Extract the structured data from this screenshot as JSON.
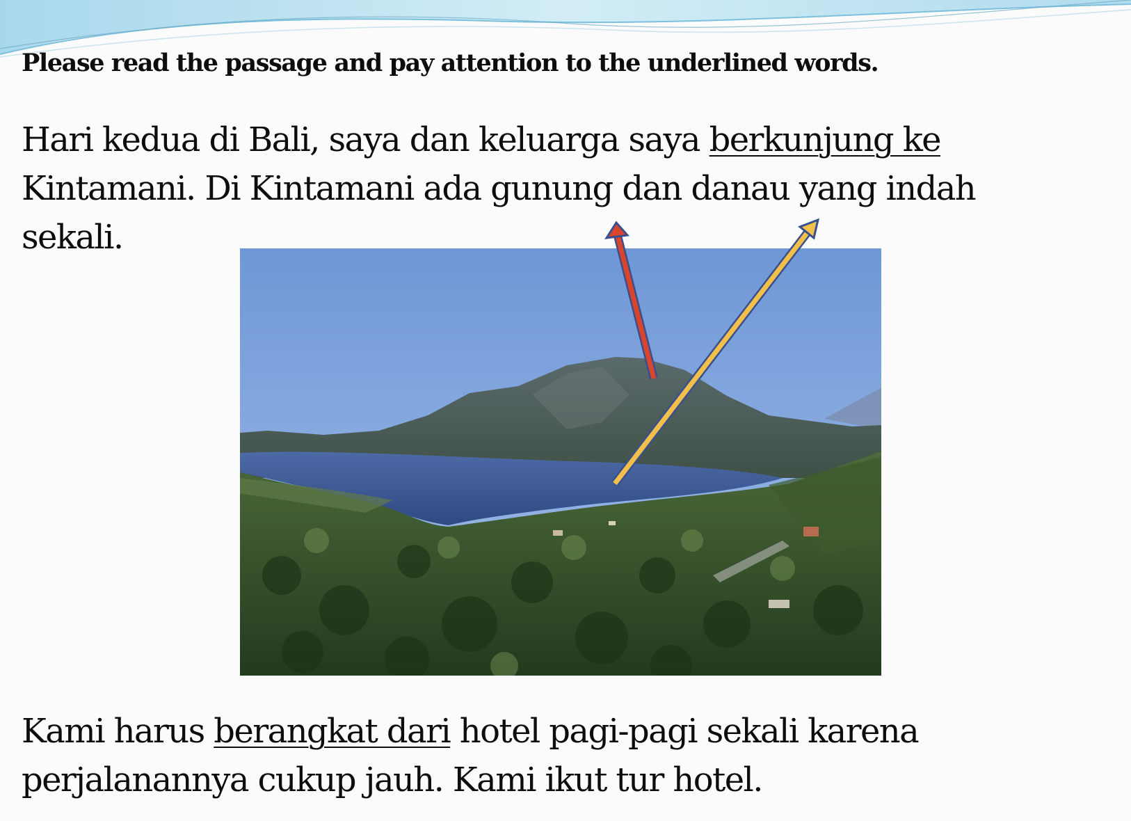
{
  "slide": {
    "instruction": "Please read the passage and pay attention to the underlined words.",
    "paragraph1": {
      "line1_before": "Hari kedua di Bali, saya dan keluarga saya ",
      "line1_underlined": "berkunjung ke",
      "line2": "Kintamani. Di Kintamani ada gunung dan danau yang indah",
      "line3": "sekali."
    },
    "paragraph2": {
      "line1_before": "Kami harus ",
      "line1_underlined": "berangkat dari",
      "line1_after": " hotel pagi-pagi sekali karena",
      "line2": "perjalanannya cukup jauh. Kami ikut tur hotel."
    }
  },
  "photo": {
    "subject": "mountain-and-lake-landscape"
  },
  "arrows": [
    {
      "name": "red-arrow",
      "points_to": "gunung",
      "color": "#d9452b"
    },
    {
      "name": "yellow-arrow",
      "points_to": "danau",
      "color": "#f0c04a"
    }
  ],
  "colors": {
    "swoosh": "#b9dfee",
    "arrow_outline": "#3b4f8f"
  }
}
